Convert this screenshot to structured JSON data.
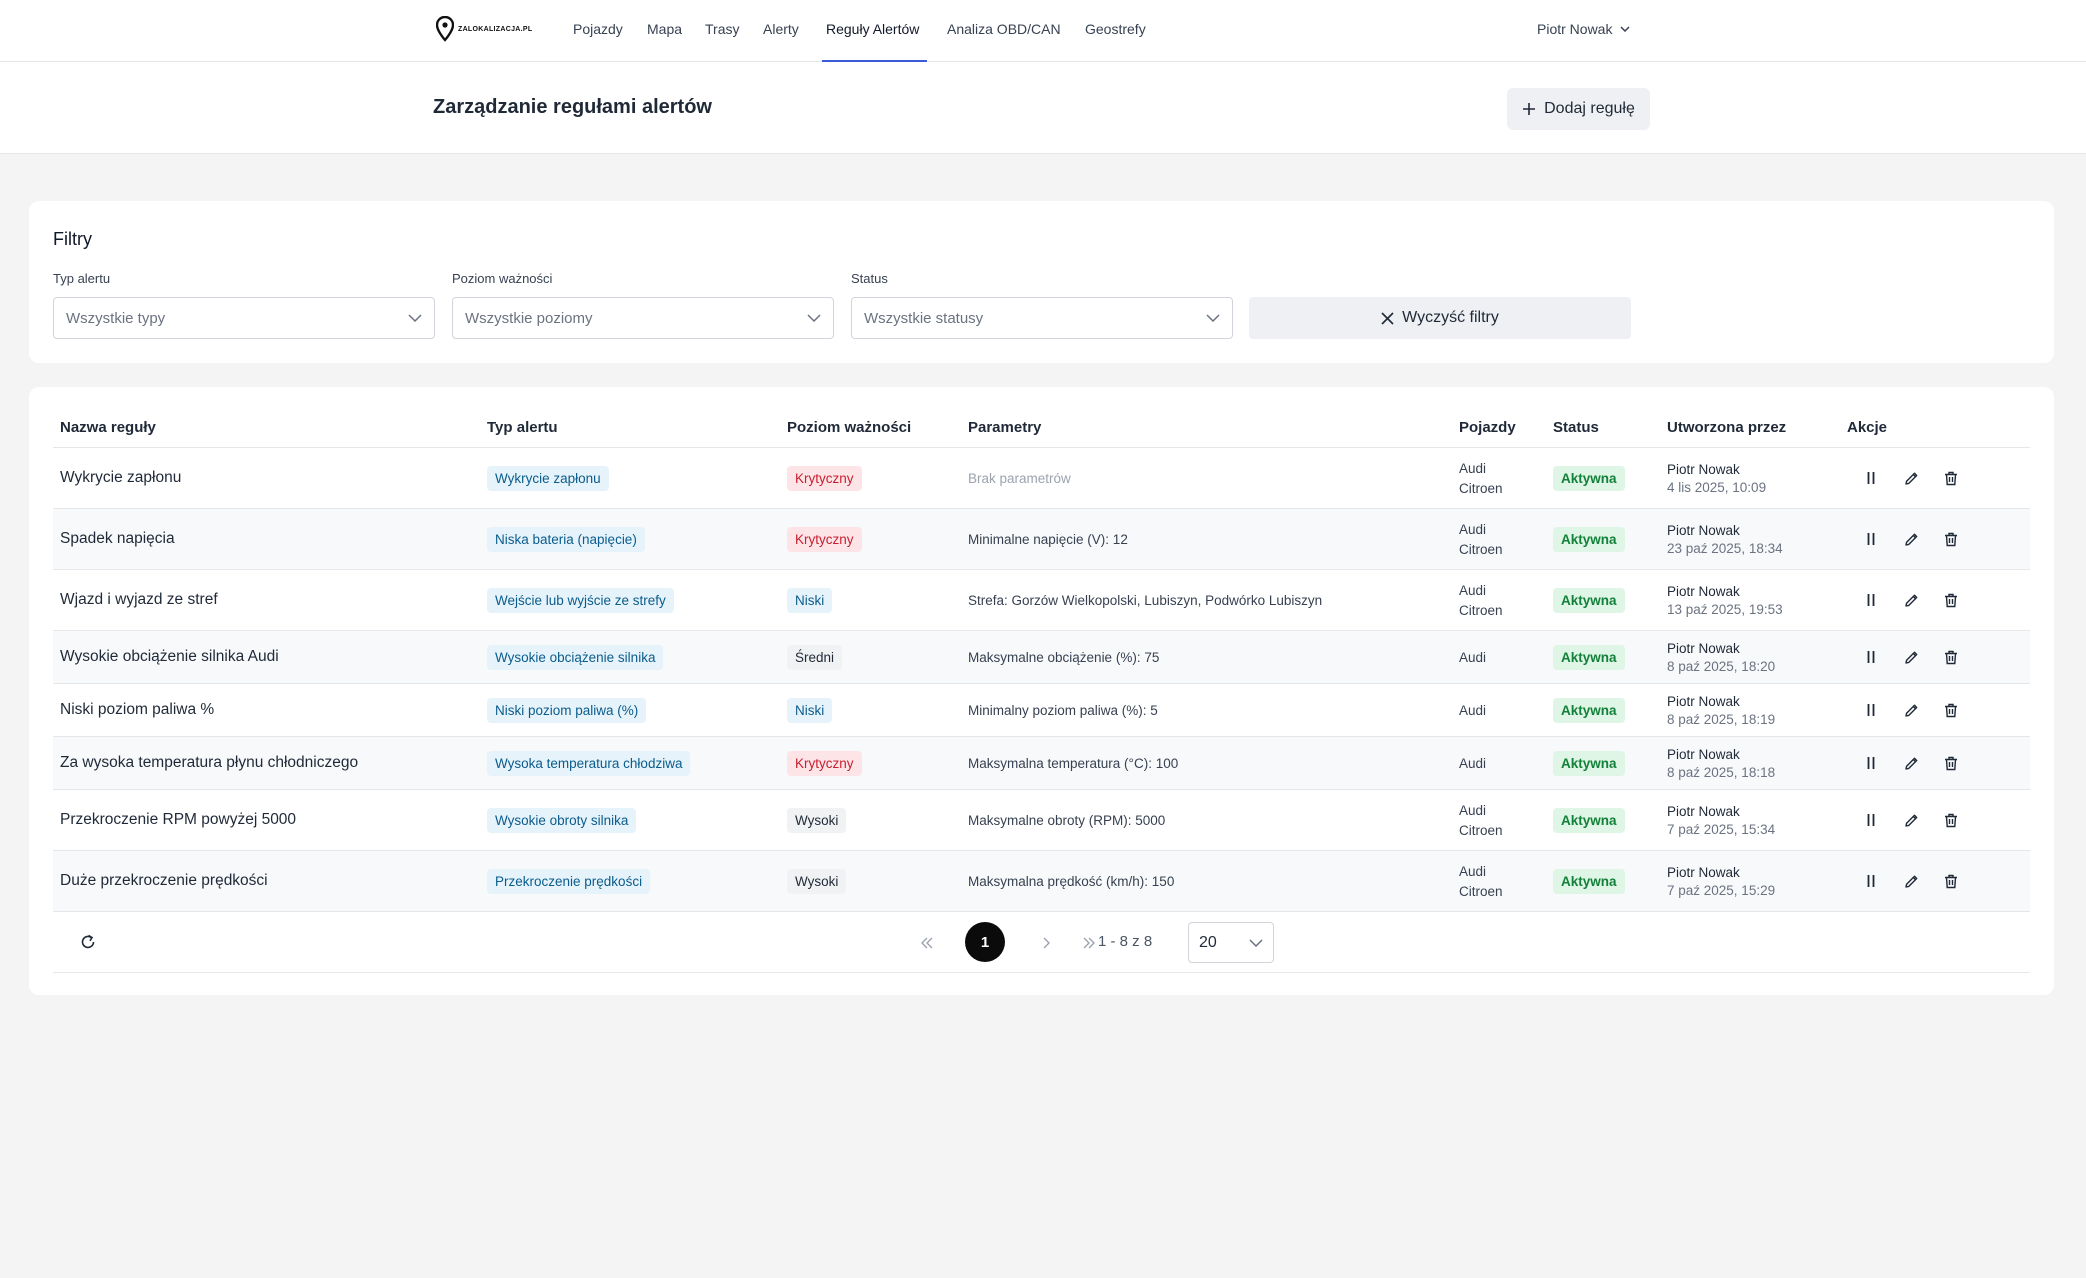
{
  "nav": {
    "logo_text": "ZALOKALIZACJA.PL",
    "items": [
      {
        "label": "Pojazdy"
      },
      {
        "label": "Mapa"
      },
      {
        "label": "Trasy"
      },
      {
        "label": "Alerty"
      },
      {
        "label": "Reguły Alertów"
      },
      {
        "label": "Analiza OBD/CAN"
      },
      {
        "label": "Geostrefy"
      }
    ],
    "active": "Reguły Alertów",
    "user_name": "Piotr Nowak"
  },
  "header": {
    "title": "Zarządzanie regułami alertów",
    "add_button": "Dodaj regułę"
  },
  "filters": {
    "title": "Filtry",
    "type_label": "Typ alertu",
    "type_value": "Wszystkie typy",
    "severity_label": "Poziom ważności",
    "severity_value": "Wszystkie poziomy",
    "status_label": "Status",
    "status_value": "Wszystkie statusy",
    "clear_button": "Wyczyść filtry"
  },
  "table": {
    "columns": {
      "name": "Nazwa reguły",
      "type": "Typ alertu",
      "severity": "Poziom ważności",
      "params": "Parametry",
      "vehicles": "Pojazdy",
      "status": "Status",
      "created_by": "Utworzona przez",
      "actions": "Akcje"
    },
    "rows": [
      {
        "name": "Wykrycie zapłonu",
        "type": "Wykrycie zapłonu",
        "severity": "Krytyczny",
        "params": "Brak parametrów",
        "v1": "Audi",
        "v2": "Citroen",
        "status": "Aktywna",
        "creator": "Piotr Nowak",
        "date": "4 lis 2025, 10:09"
      },
      {
        "name": "Spadek napięcia",
        "type": "Niska bateria (napięcie)",
        "severity": "Krytyczny",
        "params": "Minimalne napięcie (V): 12",
        "v1": "Audi",
        "v2": "Citroen",
        "status": "Aktywna",
        "creator": "Piotr Nowak",
        "date": "23 paź 2025, 18:34"
      },
      {
        "name": "Wjazd i wyjazd ze stref",
        "type": "Wejście lub wyjście ze strefy",
        "severity": "Niski",
        "params": "Strefa: Gorzów Wielkopolski, Lubiszyn, Podwórko Lubiszyn",
        "v1": "Audi",
        "v2": "Citroen",
        "status": "Aktywna",
        "creator": "Piotr Nowak",
        "date": "13 paź 2025, 19:53"
      },
      {
        "name": "Wysokie obciążenie silnika Audi",
        "type": "Wysokie obciążenie silnika",
        "severity": "Średni",
        "params": "Maksymalne obciążenie (%): 75",
        "v1": "Audi",
        "v2": "",
        "status": "Aktywna",
        "creator": "Piotr Nowak",
        "date": "8 paź 2025, 18:20"
      },
      {
        "name": "Niski poziom paliwa %",
        "type": "Niski poziom paliwa (%)",
        "severity": "Niski",
        "params": "Minimalny poziom paliwa (%): 5",
        "v1": "Audi",
        "v2": "",
        "status": "Aktywna",
        "creator": "Piotr Nowak",
        "date": "8 paź 2025, 18:19"
      },
      {
        "name": "Za wysoka temperatura płynu chłodniczego",
        "type": "Wysoka temperatura chłodziwa",
        "severity": "Krytyczny",
        "params": "Maksymalna temperatura (°C): 100",
        "v1": "Audi",
        "v2": "",
        "status": "Aktywna",
        "creator": "Piotr Nowak",
        "date": "8 paź 2025, 18:18"
      },
      {
        "name": "Przekroczenie RPM powyżej 5000",
        "type": "Wysokie obroty silnika",
        "severity": "Wysoki",
        "params": "Maksymalne obroty (RPM): 5000",
        "v1": "Audi",
        "v2": "Citroen",
        "status": "Aktywna",
        "creator": "Piotr Nowak",
        "date": "7 paź 2025, 15:34"
      },
      {
        "name": "Duże przekroczenie prędkości",
        "type": "Przekroczenie prędkości",
        "severity": "Wysoki",
        "params": "Maksymalna prędkość (km/h): 150",
        "v1": "Audi",
        "v2": "Citroen",
        "status": "Aktywna",
        "creator": "Piotr Nowak",
        "date": "7 paź 2025, 15:29"
      }
    ]
  },
  "pagination": {
    "current_page": "1",
    "range": "1 - 8 z 8",
    "page_size": "20"
  },
  "colors": {
    "accent": "#3b5bdb",
    "critical": "#c81e2f",
    "active": "#12813a",
    "info": "#0b5c8c"
  }
}
